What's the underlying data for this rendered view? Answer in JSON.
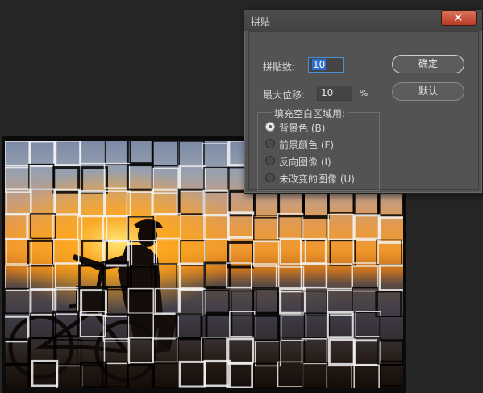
{
  "dialog": {
    "title": "拼贴",
    "close_label": "✕",
    "tile_count_label": "拼贴数:",
    "tile_count_value": "10",
    "max_offset_label": "最大位移:",
    "max_offset_value": "10",
    "max_offset_unit": "%",
    "ok_button": "确定",
    "default_button": "默认",
    "fill_group_label": "填充空白区域用:",
    "fill_options": [
      {
        "label": "背景色 (B)",
        "checked": true
      },
      {
        "label": "前景颜色 (F)",
        "checked": false
      },
      {
        "label": "反向图像 (I)",
        "checked": false
      },
      {
        "label": "未改变的图像 (U)",
        "checked": false
      }
    ]
  },
  "colors": {
    "dialog_bg": "#535353",
    "focus_border": "#4a90d9",
    "close_button": "#c8503a",
    "canvas_bg": "#262626"
  }
}
